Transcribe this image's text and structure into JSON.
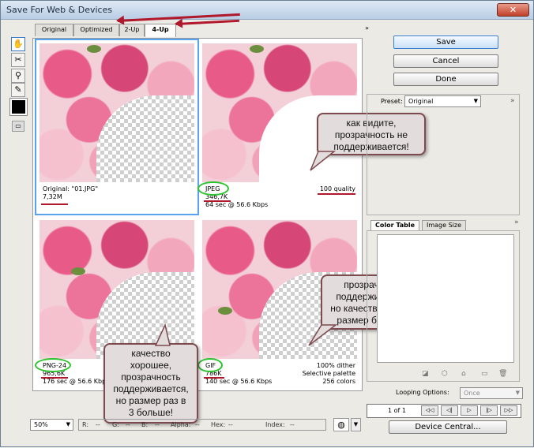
{
  "window": {
    "title": "Save For Web & Devices",
    "close_glyph": "✕"
  },
  "tabs": [
    {
      "label": "Original"
    },
    {
      "label": "Optimized"
    },
    {
      "label": "2-Up"
    },
    {
      "label": "4-Up"
    }
  ],
  "tab_scroll": "»",
  "panes": {
    "original": {
      "line1": "Original: \"01.JPG\"",
      "line2": "7,32M"
    },
    "jpeg": {
      "line1": "JPEG",
      "line2": "346,7K",
      "line3": "64 sec @ 56.6 Kbps",
      "right1": "100 quality"
    },
    "png": {
      "line1": "PNG-24",
      "line2": "965,6K",
      "line3": "176 sec @ 56.6 Kbps"
    },
    "gif": {
      "line1": "GIF",
      "line2": "786K",
      "line3": "140 sec @ 56.6 Kbps",
      "right1": "100% dither",
      "right2": "Selective palette",
      "right3": "256 colors"
    }
  },
  "callouts": {
    "jpeg": [
      "как видите,",
      "прозрачность не",
      "поддерживается!"
    ],
    "gif": [
      "прозрачность",
      "поддерживается,",
      "но качество хуже, а",
      "размер большой"
    ],
    "png": [
      "качество",
      "хорошее,",
      "прозрачность",
      "поддерживается,",
      "но размер раз в",
      "3 больше!"
    ]
  },
  "buttons": {
    "save": "Save",
    "cancel": "Cancel",
    "done": "Done",
    "device_central": "Device Central..."
  },
  "preset": {
    "label": "Preset:",
    "value": "Original"
  },
  "panel_tabs": {
    "color_table": "Color Table",
    "image_size": "Image Size"
  },
  "looping": {
    "label": "Looping Options:",
    "value": "Once"
  },
  "paging": {
    "text": "1 of 1",
    "buttons": [
      "◁◁",
      "◁|",
      "▷",
      "|▷",
      "▷▷"
    ]
  },
  "status": {
    "zoom": "50%",
    "r": "R:",
    "r_val": "--",
    "g": "G:",
    "g_val": "--",
    "b": "B:",
    "b_val": "--",
    "alpha": "Alpha:",
    "alpha_val": "--",
    "hex": "Hex:",
    "hex_val": "--",
    "index": "Index:",
    "index_val": "--"
  },
  "colors": {
    "accent": "#58a2ee",
    "annotation_red": "#b0182c",
    "annotation_green": "#2fc22f"
  }
}
